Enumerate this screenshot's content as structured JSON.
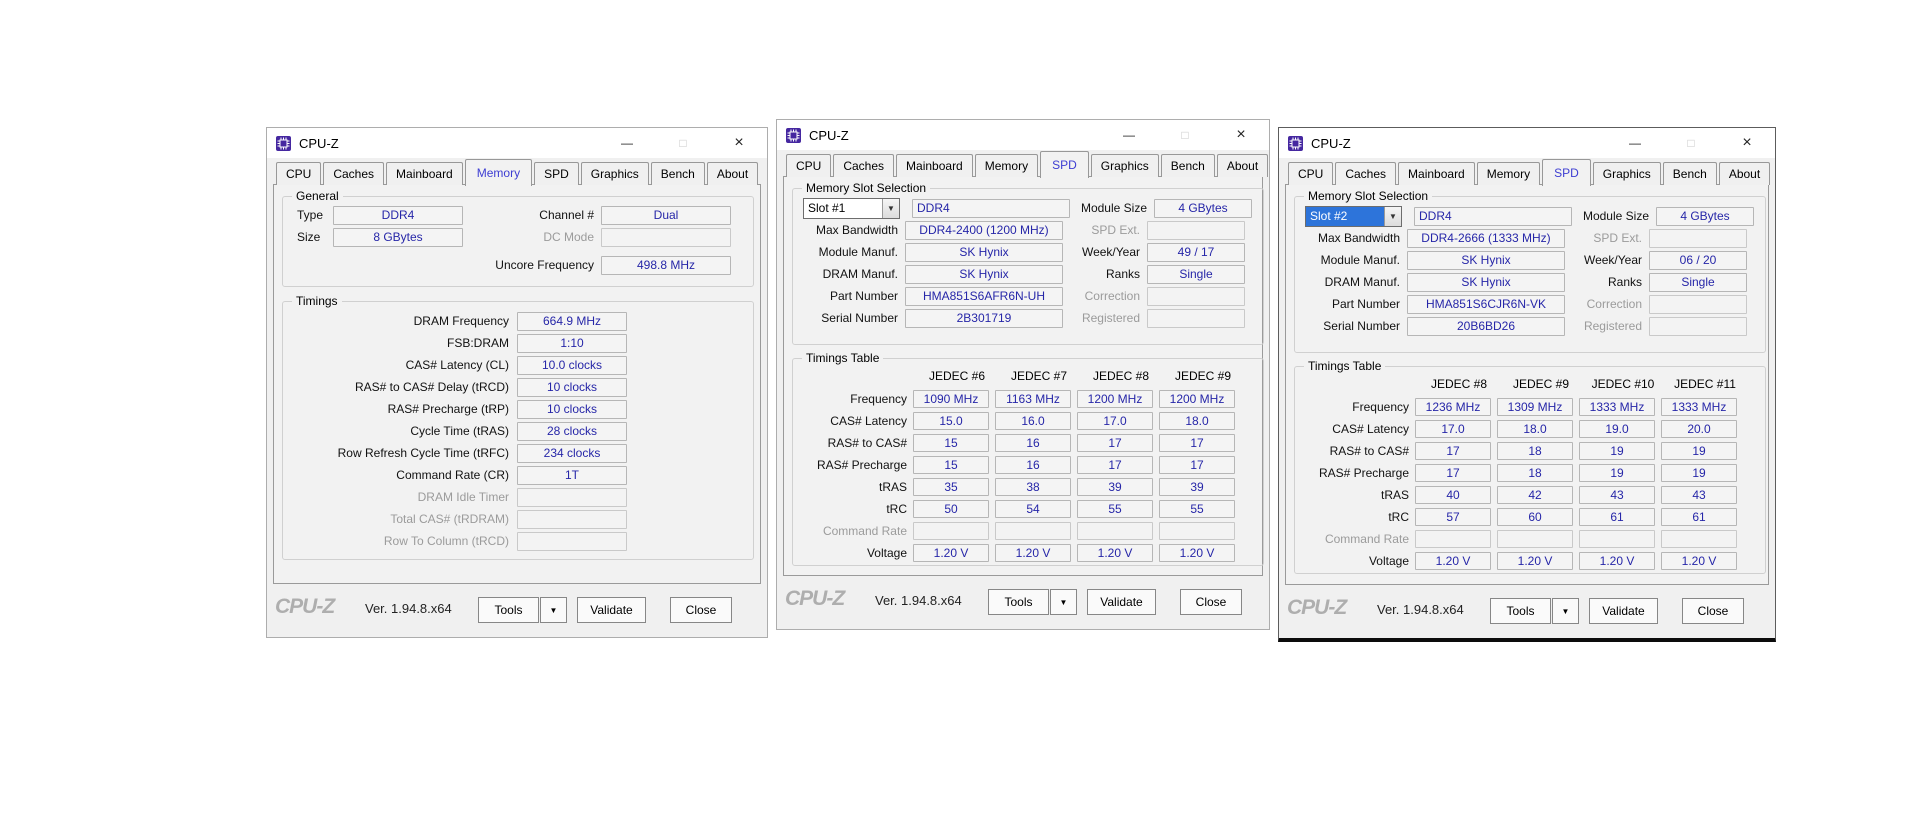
{
  "app": {
    "title": "CPU-Z"
  },
  "icons": {
    "minimize": "—",
    "maximize": "□",
    "close": "×",
    "dropdown": "▼"
  },
  "tabs": [
    "CPU",
    "Caches",
    "Mainboard",
    "Memory",
    "SPD",
    "Graphics",
    "Bench",
    "About"
  ],
  "footer": {
    "logo": "CPU-Z",
    "version": "Ver. 1.94.8.x64",
    "tools": "Tools",
    "validate": "Validate",
    "close": "Close"
  },
  "colors": {
    "value_text": "#2626a8",
    "selected_tab_text": "#3d3dd2",
    "selection_highlight": "#2d74da",
    "app_icon_purple": "#4527a0"
  },
  "memory_window": {
    "general": {
      "label": "General",
      "type_label": "Type",
      "type_value": "DDR4",
      "size_label": "Size",
      "size_value": "8 GBytes",
      "channel_label": "Channel #",
      "channel_value": "Dual",
      "dc_mode_label": "DC Mode",
      "dc_mode_value": "",
      "uncore_label": "Uncore Frequency",
      "uncore_value": "498.8 MHz"
    },
    "timings": {
      "label": "Timings",
      "rows": [
        {
          "label": "DRAM Frequency",
          "value": "664.9 MHz"
        },
        {
          "label": "FSB:DRAM",
          "value": "1:10"
        },
        {
          "label": "CAS# Latency (CL)",
          "value": "10.0 clocks"
        },
        {
          "label": "RAS# to CAS# Delay (tRCD)",
          "value": "10 clocks"
        },
        {
          "label": "RAS# Precharge (tRP)",
          "value": "10 clocks"
        },
        {
          "label": "Cycle Time (tRAS)",
          "value": "28 clocks"
        },
        {
          "label": "Row Refresh Cycle Time (tRFC)",
          "value": "234 clocks"
        },
        {
          "label": "Command Rate (CR)",
          "value": "1T"
        },
        {
          "label": "DRAM Idle Timer",
          "value": "",
          "muted": true
        },
        {
          "label": "Total CAS# (tRDRAM)",
          "value": "",
          "muted": true
        },
        {
          "label": "Row To Column (tRCD)",
          "value": "",
          "muted": true
        }
      ]
    }
  },
  "spd_slot1_window": {
    "slot_section": {
      "label": "Memory Slot Selection",
      "slot": "Slot #1",
      "memory_type": "DDR4",
      "row1_right_label": "Module Size",
      "row1_right_value": "4 GBytes",
      "rows": [
        {
          "left_label": "Max Bandwidth",
          "left_value": "DDR4-2400 (1200 MHz)",
          "right_label": "SPD Ext.",
          "right_value": "",
          "right_muted": true
        },
        {
          "left_label": "Module Manuf.",
          "left_value": "SK Hynix",
          "right_label": "Week/Year",
          "right_value": "49 / 17"
        },
        {
          "left_label": "DRAM Manuf.",
          "left_value": "SK Hynix",
          "right_label": "Ranks",
          "right_value": "Single"
        },
        {
          "left_label": "Part Number",
          "left_value": "HMA851S6AFR6N-UH",
          "right_label": "Correction",
          "right_value": "",
          "right_muted": true
        },
        {
          "left_label": "Serial Number",
          "left_value": "2B301719",
          "right_label": "Registered",
          "right_value": "",
          "right_muted": true
        }
      ]
    },
    "timings_table": {
      "label": "Timings Table",
      "columns": [
        "JEDEC #6",
        "JEDEC #7",
        "JEDEC #8",
        "JEDEC #9"
      ],
      "rows": [
        {
          "label": "Frequency",
          "values": [
            "1090 MHz",
            "1163 MHz",
            "1200 MHz",
            "1200 MHz"
          ]
        },
        {
          "label": "CAS# Latency",
          "values": [
            "15.0",
            "16.0",
            "17.0",
            "18.0"
          ]
        },
        {
          "label": "RAS# to CAS#",
          "values": [
            "15",
            "16",
            "17",
            "17"
          ]
        },
        {
          "label": "RAS# Precharge",
          "values": [
            "15",
            "16",
            "17",
            "17"
          ]
        },
        {
          "label": "tRAS",
          "values": [
            "35",
            "38",
            "39",
            "39"
          ]
        },
        {
          "label": "tRC",
          "values": [
            "50",
            "54",
            "55",
            "55"
          ]
        },
        {
          "label": "Command Rate",
          "values": [
            "",
            "",
            "",
            ""
          ],
          "muted": true
        },
        {
          "label": "Voltage",
          "values": [
            "1.20 V",
            "1.20 V",
            "1.20 V",
            "1.20 V"
          ]
        }
      ]
    }
  },
  "spd_slot2_window": {
    "slot_section": {
      "label": "Memory Slot Selection",
      "slot": "Slot #2",
      "memory_type": "DDR4",
      "row1_right_label": "Module Size",
      "row1_right_value": "4 GBytes",
      "rows": [
        {
          "left_label": "Max Bandwidth",
          "left_value": "DDR4-2666 (1333 MHz)",
          "right_label": "SPD Ext.",
          "right_value": "",
          "right_muted": true
        },
        {
          "left_label": "Module Manuf.",
          "left_value": "SK Hynix",
          "right_label": "Week/Year",
          "right_value": "06 / 20"
        },
        {
          "left_label": "DRAM Manuf.",
          "left_value": "SK Hynix",
          "right_label": "Ranks",
          "right_value": "Single"
        },
        {
          "left_label": "Part Number",
          "left_value": "HMA851S6CJR6N-VK",
          "right_label": "Correction",
          "right_value": "",
          "right_muted": true
        },
        {
          "left_label": "Serial Number",
          "left_value": "20B6BD26",
          "right_label": "Registered",
          "right_value": "",
          "right_muted": true
        }
      ]
    },
    "timings_table": {
      "label": "Timings Table",
      "columns": [
        "JEDEC #8",
        "JEDEC #9",
        "JEDEC #10",
        "JEDEC #11"
      ],
      "rows": [
        {
          "label": "Frequency",
          "values": [
            "1236 MHz",
            "1309 MHz",
            "1333 MHz",
            "1333 MHz"
          ]
        },
        {
          "label": "CAS# Latency",
          "values": [
            "17.0",
            "18.0",
            "19.0",
            "20.0"
          ]
        },
        {
          "label": "RAS# to CAS#",
          "values": [
            "17",
            "18",
            "19",
            "19"
          ]
        },
        {
          "label": "RAS# Precharge",
          "values": [
            "17",
            "18",
            "19",
            "19"
          ]
        },
        {
          "label": "tRAS",
          "values": [
            "40",
            "42",
            "43",
            "43"
          ]
        },
        {
          "label": "tRC",
          "values": [
            "57",
            "60",
            "61",
            "61"
          ]
        },
        {
          "label": "Command Rate",
          "values": [
            "",
            "",
            "",
            ""
          ],
          "muted": true
        },
        {
          "label": "Voltage",
          "values": [
            "1.20 V",
            "1.20 V",
            "1.20 V",
            "1.20 V"
          ]
        }
      ]
    }
  }
}
